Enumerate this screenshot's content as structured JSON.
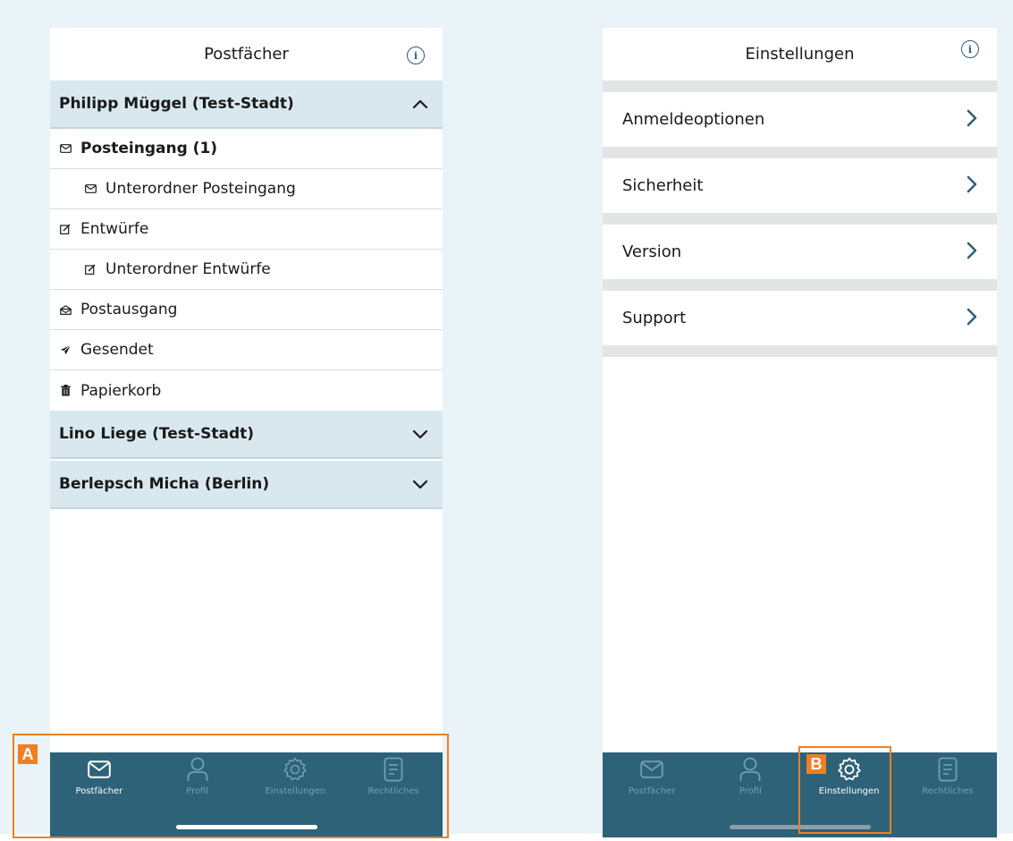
{
  "left_screen": {
    "title": "Postfächer",
    "accounts": [
      {
        "name": "Philipp Müggel (Test-Stadt)",
        "expanded": true,
        "folders": [
          {
            "label": "Posteingang (1)",
            "icon": "envelope-icon",
            "bold": true,
            "sub": false
          },
          {
            "label": "Unterordner Posteingang",
            "icon": "envelope-icon",
            "bold": false,
            "sub": true
          },
          {
            "label": "Entwürfe",
            "icon": "draft-icon",
            "bold": false,
            "sub": false
          },
          {
            "label": "Unterordner Entwürfe",
            "icon": "draft-icon",
            "bold": false,
            "sub": true
          },
          {
            "label": "Postausgang",
            "icon": "outbox-icon",
            "bold": false,
            "sub": false
          },
          {
            "label": "Gesendet",
            "icon": "paper-plane-icon",
            "bold": false,
            "sub": false
          },
          {
            "label": "Papierkorb",
            "icon": "trash-icon",
            "bold": false,
            "sub": false
          }
        ]
      },
      {
        "name": "Lino Liege (Test-Stadt)",
        "expanded": false
      },
      {
        "name": "Berlepsch Micha (Berlin)",
        "expanded": false
      }
    ],
    "tabbar": {
      "active": "Postfächer",
      "tabs": [
        "Postfächer",
        "Profil",
        "Einstellungen",
        "Rechtliches"
      ]
    }
  },
  "right_screen": {
    "title": "Einstellungen",
    "rows": [
      "Anmeldeoptionen",
      "Sicherheit",
      "Version",
      "Support"
    ],
    "tabbar": {
      "active": "Einstellungen",
      "tabs": [
        "Postfächer",
        "Profil",
        "Einstellungen",
        "Rechtliches"
      ]
    }
  },
  "callouts": {
    "a": "A",
    "b": "B"
  },
  "colors": {
    "tabbar": "#2d6278",
    "account_header": "#d9e8ef",
    "accent": "#2d5f78",
    "callout": "#f07f22"
  }
}
